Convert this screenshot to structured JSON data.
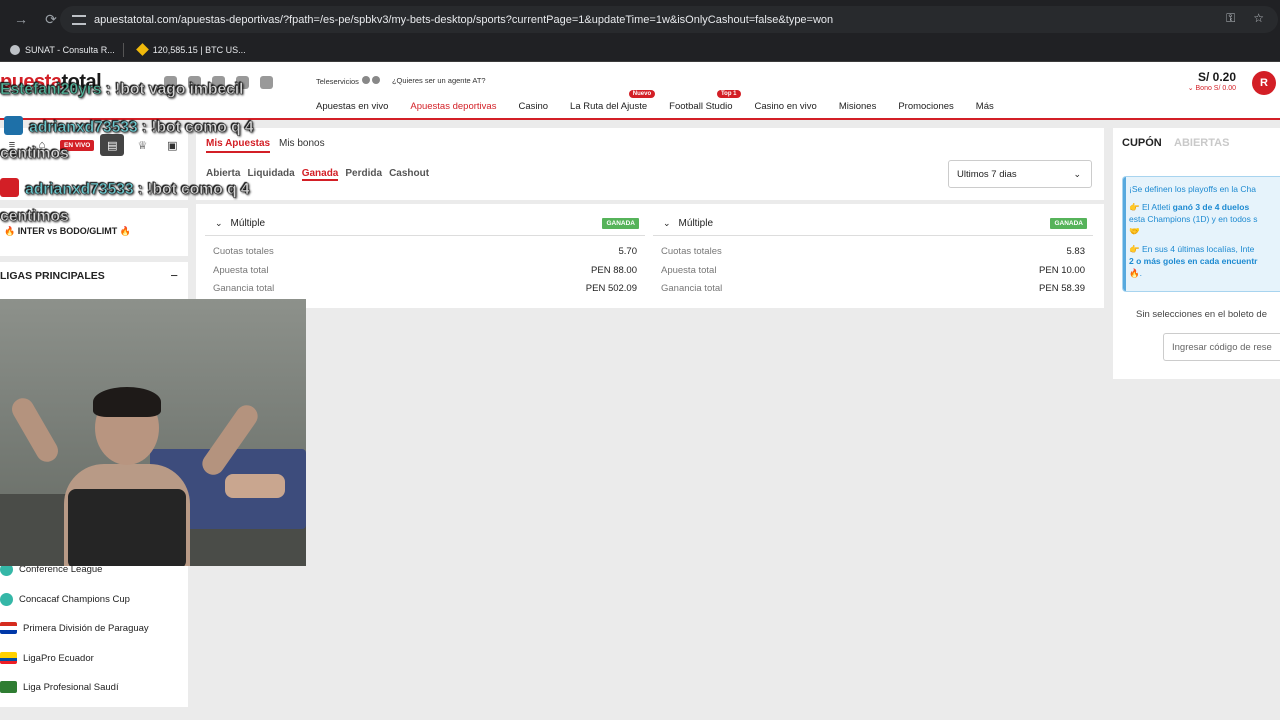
{
  "browser": {
    "url": "apuestatotal.com/apuestas-deportivas/?fpath=/es-pe/spbkv3/my-bets-desktop/sports?currentPage=1&updateTime=1w&isOnlyCashout=false&type=won",
    "bookmarks": [
      "SUNAT - Consulta R...",
      "120,585.15 | BTC US..."
    ]
  },
  "header": {
    "logo_red": "puesta",
    "logo_dark": "total",
    "teleservicios": "Teleservicios",
    "agente": "¿Quieres ser un agente AT?",
    "nav": [
      {
        "label": "Apuestas en vivo",
        "tag": ""
      },
      {
        "label": "Apuestas deportivas",
        "tag": ""
      },
      {
        "label": "Casino",
        "tag": ""
      },
      {
        "label": "La Ruta del Ajuste",
        "tag": "Nuevo"
      },
      {
        "label": "Football Studio",
        "tag": "Top 1"
      },
      {
        "label": "Casino en vivo",
        "tag": ""
      },
      {
        "label": "Misiones",
        "tag": ""
      },
      {
        "label": "Promociones",
        "tag": ""
      },
      {
        "label": "Más",
        "tag": ""
      }
    ],
    "balance": "S/ 0.20",
    "bono": "Bono S/ 0.00",
    "avatar": "R"
  },
  "sidebar": {
    "envivo": "EN VIVO",
    "match": "INTER vs BODO/GLIMT",
    "ligas_title": "LIGAS PRINCIPALES",
    "ligas": [
      "Conference League",
      "Concacaf Champions Cup",
      "Primera División de Paraguay",
      "LigaPro Ecuador",
      "Liga Profesional Saudí"
    ]
  },
  "bets": {
    "tab_mis_apuestas": "Mis Apuestas",
    "tab_mis_bonos": "Mis bonos",
    "filters": [
      "Abierta",
      "Liquidada",
      "Ganada",
      "Perdida",
      "Cashout"
    ],
    "period": "Ultimos 7 dias",
    "cards": [
      {
        "type": "Múltiple",
        "status": "GANADA",
        "cuotas": "5.70",
        "apuesta": "PEN 88.00",
        "ganancia": "PEN 502.09"
      },
      {
        "type": "Múltiple",
        "status": "GANADA",
        "cuotas": "5.83",
        "apuesta": "PEN 10.00",
        "ganancia": "PEN 58.39"
      }
    ],
    "labels": {
      "cuotas": "Cuotas totales",
      "apuesta": "Apuesta total",
      "ganancia": "Ganancia total"
    }
  },
  "coupon": {
    "tab_cupon": "CUPÓN",
    "tab_abiertas": "ABIERTAS",
    "promo_line1": "¡Se definen los playoffs en la Cha",
    "promo_line2a": "👉 El Atleti ",
    "promo_line2b": "ganó 3 de 4 duelos",
    "promo_line3": "esta Champions (1D) y en todos s",
    "promo_line4": "🤝",
    "promo_line5": "👉 En sus 4 últimas localías, Inte",
    "promo_line6": "2 o más goles en cada encuentr",
    "promo_line7": "🔥.",
    "empty": "Sin selecciones en el boleto de",
    "code_placeholder": "Ingresar código de rese"
  },
  "chat": [
    {
      "user": "Estefani20yrs",
      "msg": ": !bot vago imbecil"
    },
    {
      "user": "adrianxd73533",
      "msg": ": !bot como q 4"
    },
    {
      "user": "",
      "msg": "centimos"
    },
    {
      "user": "adrianxd73533",
      "msg": ": !bot como q 4"
    },
    {
      "user": "",
      "msg": "centimos"
    }
  ],
  "colors": {
    "brand_red": "#d31f26",
    "won_green": "#56b35a",
    "promo_blue": "#1d8ad1"
  }
}
